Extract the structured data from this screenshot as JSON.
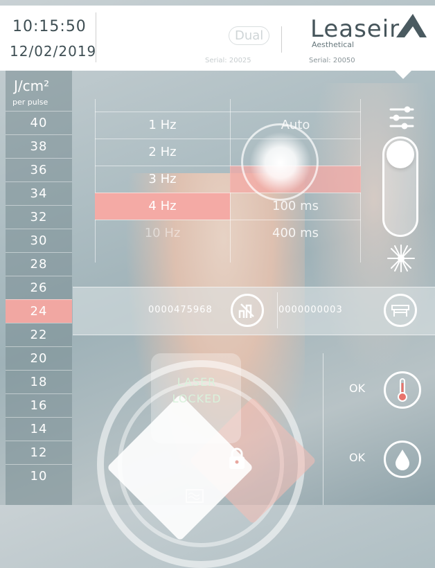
{
  "header": {
    "clock_time": "10:15:50",
    "clock_date": "12/02/2019",
    "brand_name": "Leaseir",
    "brand_sub": "Aesthetical",
    "serial": "Serial: 20050",
    "dual_logo": "Dual",
    "serial_secondary": "Serial: 20025"
  },
  "fluence": {
    "unit": "J/cm²",
    "unit_sub": "per pulse",
    "items": [
      "40",
      "38",
      "36",
      "34",
      "32",
      "30",
      "28",
      "26",
      "24",
      "22",
      "20",
      "18",
      "16",
      "14",
      "12",
      "10"
    ],
    "selected": "24"
  },
  "frequency": {
    "items": [
      "1 Hz",
      "2 Hz",
      "3 Hz",
      "4 Hz",
      "10 Hz"
    ],
    "selected": "4 Hz"
  },
  "duration": {
    "items": [
      "Auto",
      "",
      "",
      "100 ms",
      "400 ms"
    ],
    "selected_index": 2
  },
  "counters": {
    "pulse_count": "0000475968",
    "session_count": "0000000003"
  },
  "status": {
    "temperature": "OK",
    "water": "OK"
  },
  "laser": {
    "line1": "LASER",
    "line2": "LOCKED"
  },
  "colors": {
    "selection": "#f1a7a2",
    "text_dark": "#3e4e53"
  },
  "icons": [
    "settings-sliders-icon",
    "laser-spark-icon",
    "pulse-counter-icon",
    "handpiece-icon",
    "thermometer-icon",
    "water-drop-icon",
    "lock-icon",
    "waves-icon"
  ]
}
